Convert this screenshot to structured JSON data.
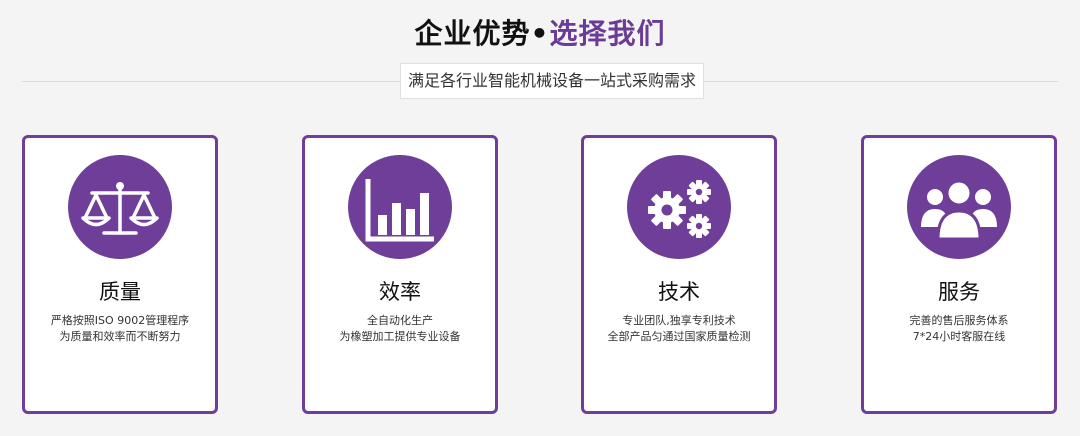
{
  "header": {
    "title_main": "企业优势",
    "title_sep": "•",
    "title_highlight": "选择我们",
    "subtitle": "满足各行业智能机械设备一站式采购需求"
  },
  "colors": {
    "accent": "#6f3e98",
    "background": "#f4f4f4"
  },
  "cards": [
    {
      "icon": "scale-icon",
      "title": "质量",
      "line1": "严格按照ISO 9002管理程序",
      "line2": "为质量和效率而不断努力"
    },
    {
      "icon": "bar-chart-icon",
      "title": "效率",
      "line1": "全自动化生产",
      "line2": "为橡塑加工提供专业设备"
    },
    {
      "icon": "gears-icon",
      "title": "技术",
      "line1": "专业团队,独享专利技术",
      "line2": "全部产品匀通过国家质量检测"
    },
    {
      "icon": "users-icon",
      "title": "服务",
      "line1": "完善的售后服务体系",
      "line2": "7*24小时客服在线"
    }
  ]
}
